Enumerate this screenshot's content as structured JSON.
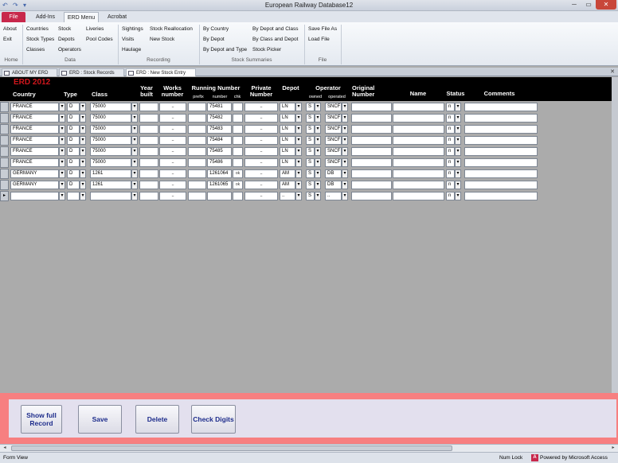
{
  "window": {
    "title": "European Railway Database12",
    "min": "─",
    "max": "▭",
    "close": "✕"
  },
  "qat": [
    "↶",
    "↷",
    "▾"
  ],
  "tabs": [
    "File",
    "Add-Ins",
    "ERD Menu",
    "Acrobat"
  ],
  "ribbon": {
    "home": {
      "items": [
        "About",
        "Exit"
      ],
      "group": "Home"
    },
    "data": {
      "items": [
        "Countries",
        "Stock Types",
        "Classes",
        "Stock",
        "Depots",
        "Operators",
        "Liveries",
        "Pool Codes"
      ],
      "group": "Data"
    },
    "recording": {
      "items": [
        "Sightings",
        "Visits",
        "Haulage",
        "Stock Reallocation",
        "New Stock"
      ],
      "group": "Recording"
    },
    "summaries": {
      "items": [
        "By Country",
        "By Depot",
        "By Depot and Type",
        "By Depot and Class",
        "By Class and Depot",
        "Stock Picker"
      ],
      "group": "Stock Summaries"
    },
    "file": {
      "items": [
        "Save File As",
        "Load File"
      ],
      "group": "File"
    }
  },
  "doc_tabs": [
    "ABOUT MY ERD",
    "ERD : Stock Records",
    "ERD : New Stock Entry"
  ],
  "doc_close": "✕",
  "header": {
    "brand": "ERD 2012",
    "country": "Country",
    "type": "Type",
    "class": "Class",
    "year": "Year built",
    "works": "Works number",
    "running": "Running Number",
    "prefix": "prefix",
    "number": "number",
    "chk": "chk",
    "private": "Private Number",
    "depot": "Depot",
    "operator": "Operator",
    "owned": "owned",
    "operated": "operated",
    "original": "Original Number",
    "name": "Name",
    "status": "Status",
    "comments": "Comments"
  },
  "rows": [
    {
      "country": "FRANCE",
      "type": "D",
      "class": "75000",
      "works": "..",
      "number": "75481",
      "chk": "",
      "private": "..",
      "depot": "LN",
      "owned": "S",
      "operated": "SNCF",
      "status": "n"
    },
    {
      "country": "FRANCE",
      "type": "D",
      "class": "75000",
      "works": "..",
      "number": "75482",
      "chk": "",
      "private": "..",
      "depot": "LN",
      "owned": "S",
      "operated": "SNCF",
      "status": "n"
    },
    {
      "country": "FRANCE",
      "type": "D",
      "class": "75000",
      "works": "..",
      "number": "75483",
      "chk": "",
      "private": "..",
      "depot": "LN",
      "owned": "S",
      "operated": "SNCF",
      "status": "n"
    },
    {
      "country": "FRANCE",
      "type": "D",
      "class": "75000",
      "works": "..",
      "number": "75484",
      "chk": "",
      "private": "..",
      "depot": "LN",
      "owned": "S",
      "operated": "SNCF",
      "status": "n"
    },
    {
      "country": "FRANCE",
      "type": "D",
      "class": "75000",
      "works": "..",
      "number": "75485",
      "chk": "",
      "private": "..",
      "depot": "LN",
      "owned": "S",
      "operated": "SNCF",
      "status": "n"
    },
    {
      "country": "FRANCE",
      "type": "D",
      "class": "75000",
      "works": "..",
      "number": "75486",
      "chk": "",
      "private": "..",
      "depot": "LN",
      "owned": "S",
      "operated": "SNCF",
      "status": "n"
    },
    {
      "country": "GERMANY",
      "type": "D",
      "class": "1261",
      "works": "..",
      "number": "1261064",
      "chk": "ok",
      "private": "..",
      "depot": "AM",
      "owned": "S",
      "operated": "DB",
      "status": "n"
    },
    {
      "country": "GERMANY",
      "type": "D",
      "class": "1261",
      "works": "..",
      "number": "1261065",
      "chk": "ok",
      "private": "..",
      "depot": "AM",
      "owned": "S",
      "operated": "DB",
      "status": "n"
    },
    {
      "country": "",
      "type": "",
      "class": "",
      "works": "..",
      "number": "",
      "chk": "",
      "private": "..",
      "depot": "..",
      "owned": "S",
      "operated": "..",
      "status": "n"
    }
  ],
  "buttons": {
    "show_full": "Show full Record",
    "save": "Save",
    "delete": "Delete",
    "check_digits": "Check Digits"
  },
  "status": {
    "view": "Form View",
    "numlock": "Num Lock",
    "powered": "Powered by Microsoft Access",
    "logo": "A"
  },
  "scroll": {
    "left": "◂",
    "right": "▸"
  }
}
